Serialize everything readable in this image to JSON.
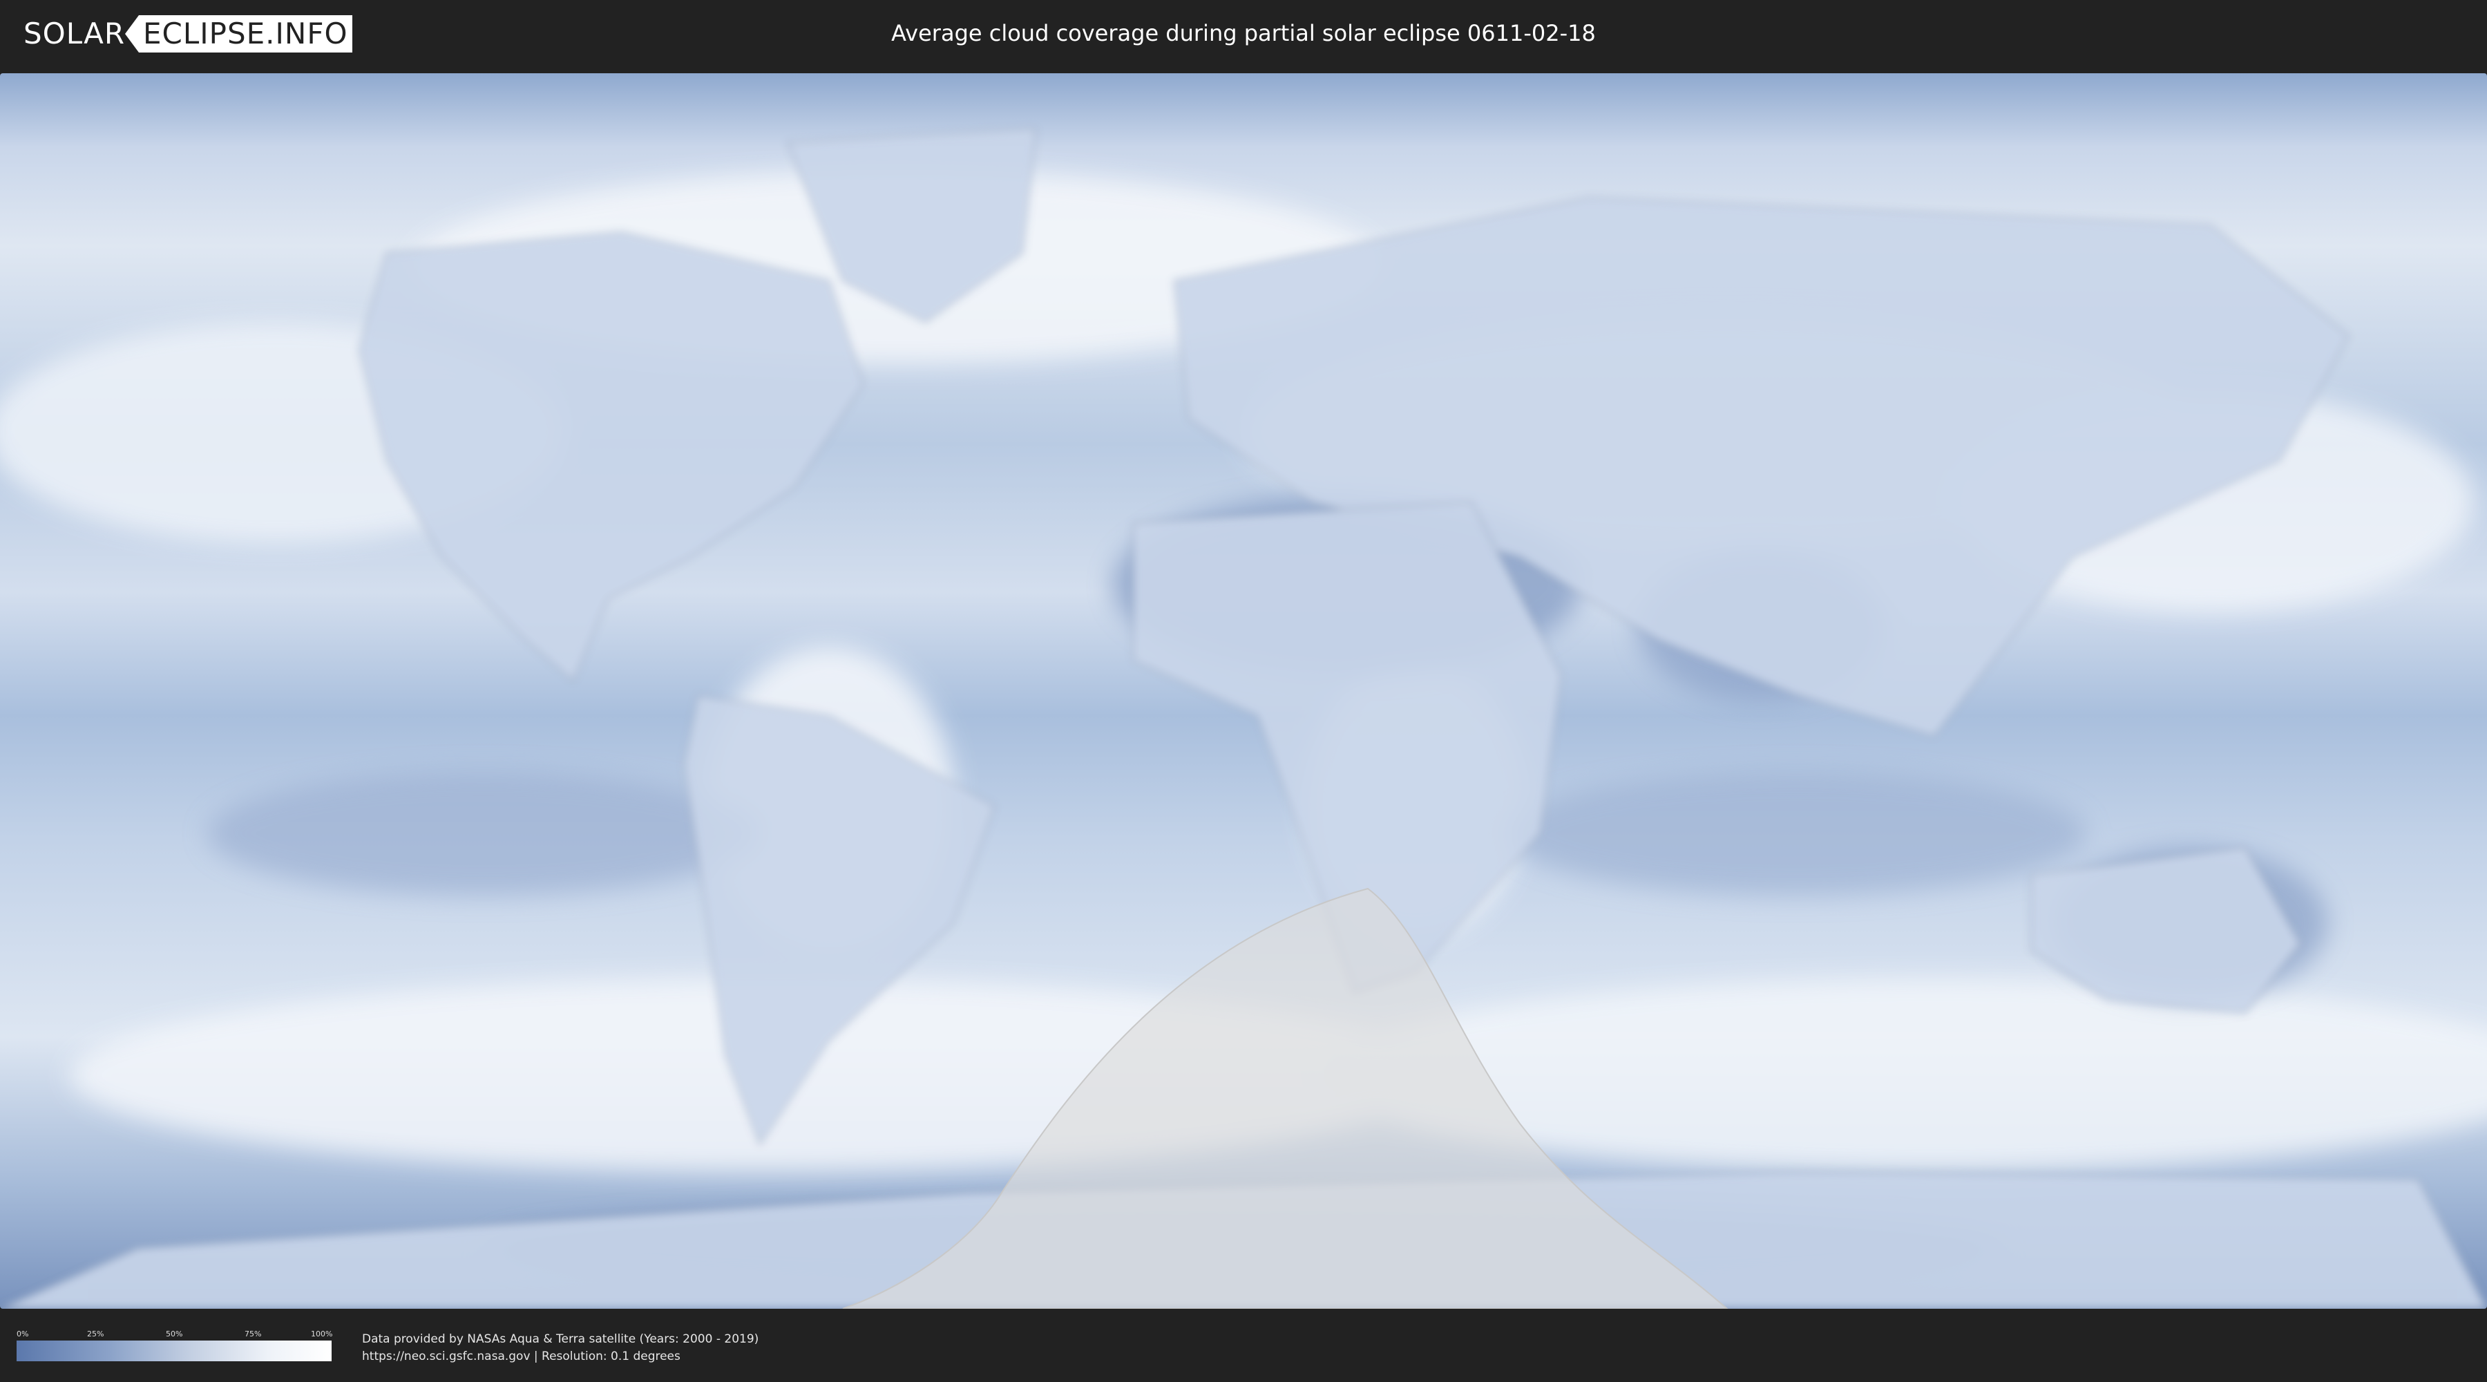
{
  "header": {
    "logo_left": "SOLAR",
    "logo_right": "ECLIPSE.INFO",
    "title": "Average cloud coverage during partial solar eclipse 0611-02-18"
  },
  "map": {
    "description_colors": {
      "ocean_cloud_low": "#7e98c3",
      "cloud_high": "#ffffff",
      "eclipse_zone": "#dcdcdc"
    }
  },
  "legend": {
    "ticks": [
      "0%",
      "25%",
      "50%",
      "75%",
      "100%"
    ],
    "gradient_start": "#5b78ac",
    "gradient_end": "#ffffff"
  },
  "footer": {
    "credit_line1": "Data provided by NASAs Aqua & Terra satellite (Years: 2000 - 2019)",
    "credit_line2": "https://neo.sci.gsfc.nasa.gov | Resolution: 0.1 degrees"
  }
}
